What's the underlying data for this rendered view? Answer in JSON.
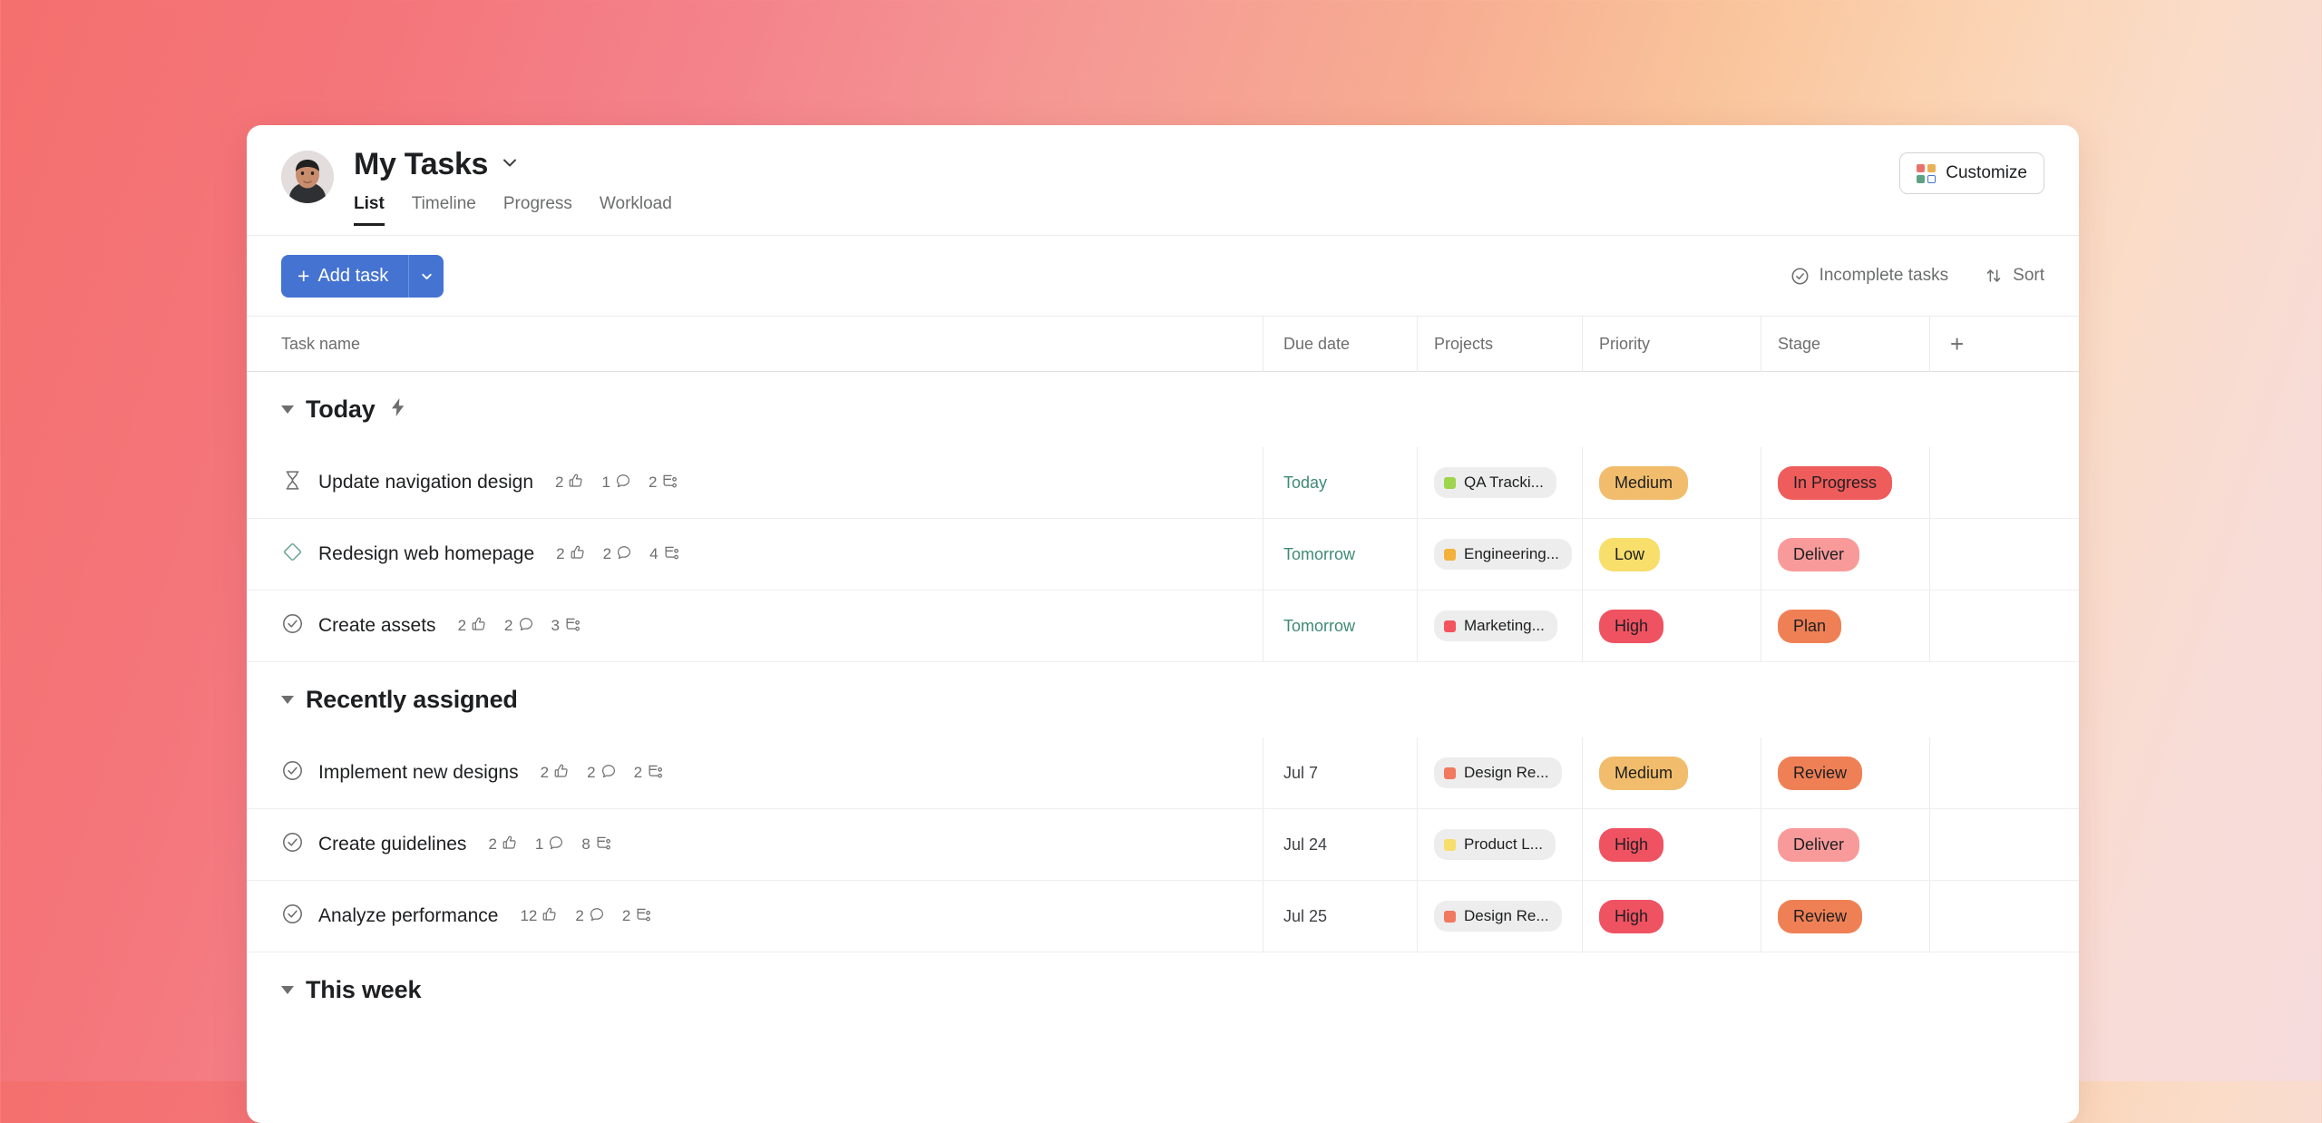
{
  "header": {
    "title": "My Tasks",
    "avatar_name": "user-avatar",
    "tabs": [
      {
        "label": "List",
        "active": true
      },
      {
        "label": "Timeline",
        "active": false
      },
      {
        "label": "Progress",
        "active": false
      },
      {
        "label": "Workload",
        "active": false
      }
    ],
    "customize_label": "Customize",
    "customize_colors": [
      "#e8736c",
      "#eab054",
      "#5da283",
      "#4573d2"
    ]
  },
  "toolbar": {
    "add_task_label": "Add task",
    "add_task_plus": "+",
    "incomplete_label": "Incomplete tasks",
    "sort_label": "Sort"
  },
  "table": {
    "columns": [
      "Task name",
      "Due date",
      "Projects",
      "Priority",
      "Stage"
    ],
    "add_column_glyph": "+"
  },
  "sections": [
    {
      "name": "Today",
      "badge": "lightning",
      "rows": [
        {
          "status_icon": "hourglass",
          "name": "Update navigation design",
          "likes": "2",
          "comments": "1",
          "subtasks": "2",
          "due": "Today",
          "due_soon": true,
          "project": "QA Tracki...",
          "project_color": "#9fd44d",
          "priority": "Medium",
          "priority_bg": "#f1bd6c",
          "stage": "In Progress",
          "stage_bg": "#ef5c5c"
        },
        {
          "status_icon": "diamond",
          "name": "Redesign web homepage",
          "likes": "2",
          "comments": "2",
          "subtasks": "4",
          "due": "Tomorrow",
          "due_soon": true,
          "project": "Engineering...",
          "project_color": "#f3b13c",
          "priority": "Low",
          "priority_bg": "#f8df6c",
          "stage": "Deliver",
          "stage_bg": "#f99a9a"
        },
        {
          "status_icon": "check",
          "name": "Create assets",
          "likes": "2",
          "comments": "2",
          "subtasks": "3",
          "due": "Tomorrow",
          "due_soon": true,
          "project": "Marketing...",
          "project_color": "#f3555f",
          "priority": "High",
          "priority_bg": "#ef5261",
          "stage": "Plan",
          "stage_bg": "#ef8055"
        }
      ]
    },
    {
      "name": "Recently assigned",
      "badge": "",
      "rows": [
        {
          "status_icon": "check",
          "name": "Implement new designs",
          "likes": "2",
          "comments": "2",
          "subtasks": "2",
          "due": "Jul 7",
          "due_soon": false,
          "project": "Design Re...",
          "project_color": "#f0795e",
          "priority": "Medium",
          "priority_bg": "#f1bd6c",
          "stage": "Review",
          "stage_bg": "#ef8055"
        },
        {
          "status_icon": "check",
          "name": "Create guidelines",
          "likes": "2",
          "comments": "1",
          "subtasks": "8",
          "due": "Jul 24",
          "due_soon": false,
          "project": "Product L...",
          "project_color": "#f7df6b",
          "priority": "High",
          "priority_bg": "#ef5261",
          "stage": "Deliver",
          "stage_bg": "#f99a9a"
        },
        {
          "status_icon": "check",
          "name": "Analyze performance",
          "likes": "12",
          "comments": "2",
          "subtasks": "2",
          "due": "Jul 25",
          "due_soon": false,
          "project": "Design Re...",
          "project_color": "#f0795e",
          "priority": "High",
          "priority_bg": "#ef5261",
          "stage": "Review",
          "stage_bg": "#ef8055"
        }
      ]
    },
    {
      "name": "This week",
      "badge": "",
      "rows": []
    }
  ]
}
